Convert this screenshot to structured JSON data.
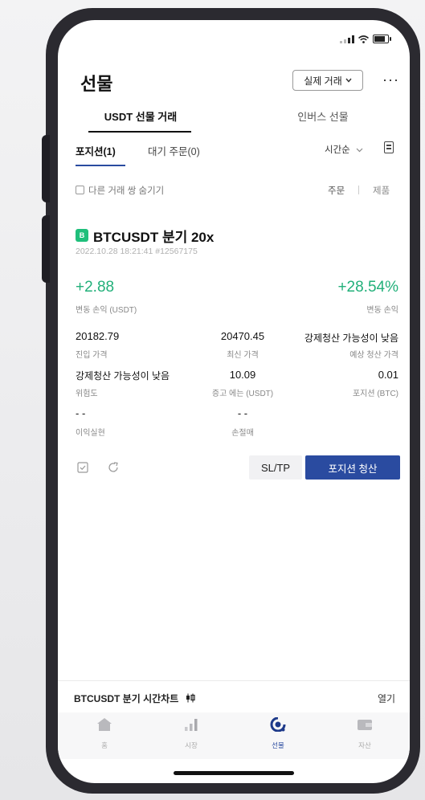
{
  "page": {
    "title": "선물",
    "mode_select": "실제 거래",
    "more": "···"
  },
  "tabs": [
    {
      "label": "USDT 선물 거래",
      "active": true
    },
    {
      "label": "인버스 선물",
      "active": false
    }
  ],
  "subtabs": {
    "positions": "포지션(1)",
    "pending": "대기 주문(0)",
    "sort": "시간순"
  },
  "filter": {
    "hide_label": "다른 거래 쌍 숨기기",
    "order": "주문",
    "product": "제품"
  },
  "position": {
    "badge": "B",
    "symbol": "BTCUSDT 분기 20x",
    "meta": "2022.10.28 18:21:41 #12567175",
    "pnl": "+2.88",
    "pnl_label": "변동 손익 (USDT)",
    "roe": "+28.54%",
    "roe_label": "변동 손익",
    "entry_price": "20182.79",
    "entry_label": "진입 가격",
    "last_price": "20470.45",
    "last_label": "최신 가격",
    "liq_price": "강제청산 가능성이 낮음",
    "liq_label": "예상 청산 가격",
    "risk": "강제청산 가능성이 낮음",
    "risk_label": "위험도",
    "margin": "10.09",
    "margin_label": "증고 에는 (USDT)",
    "size": "0.01",
    "size_label": "포지션 (BTC)",
    "tp": "- -",
    "tp_label": "이익실현",
    "sl": "- -",
    "sl_label": "손절매",
    "sltp_button": "SL/TP",
    "close_button": "포지션 청산"
  },
  "chart_bar": {
    "label": "BTCUSDT 분기  시간차트",
    "open": "열기"
  },
  "nav": [
    {
      "label": "홈",
      "icon": "home-icon",
      "active": false
    },
    {
      "label": "시장",
      "icon": "market-icon",
      "active": false
    },
    {
      "label": "선물",
      "icon": "futures-icon",
      "active": true
    },
    {
      "label": "자산",
      "icon": "wallet-icon",
      "active": false
    }
  ],
  "colors": {
    "accent": "#2a4ba0",
    "profit": "#22b07a",
    "badge": "#1fbf7b"
  }
}
